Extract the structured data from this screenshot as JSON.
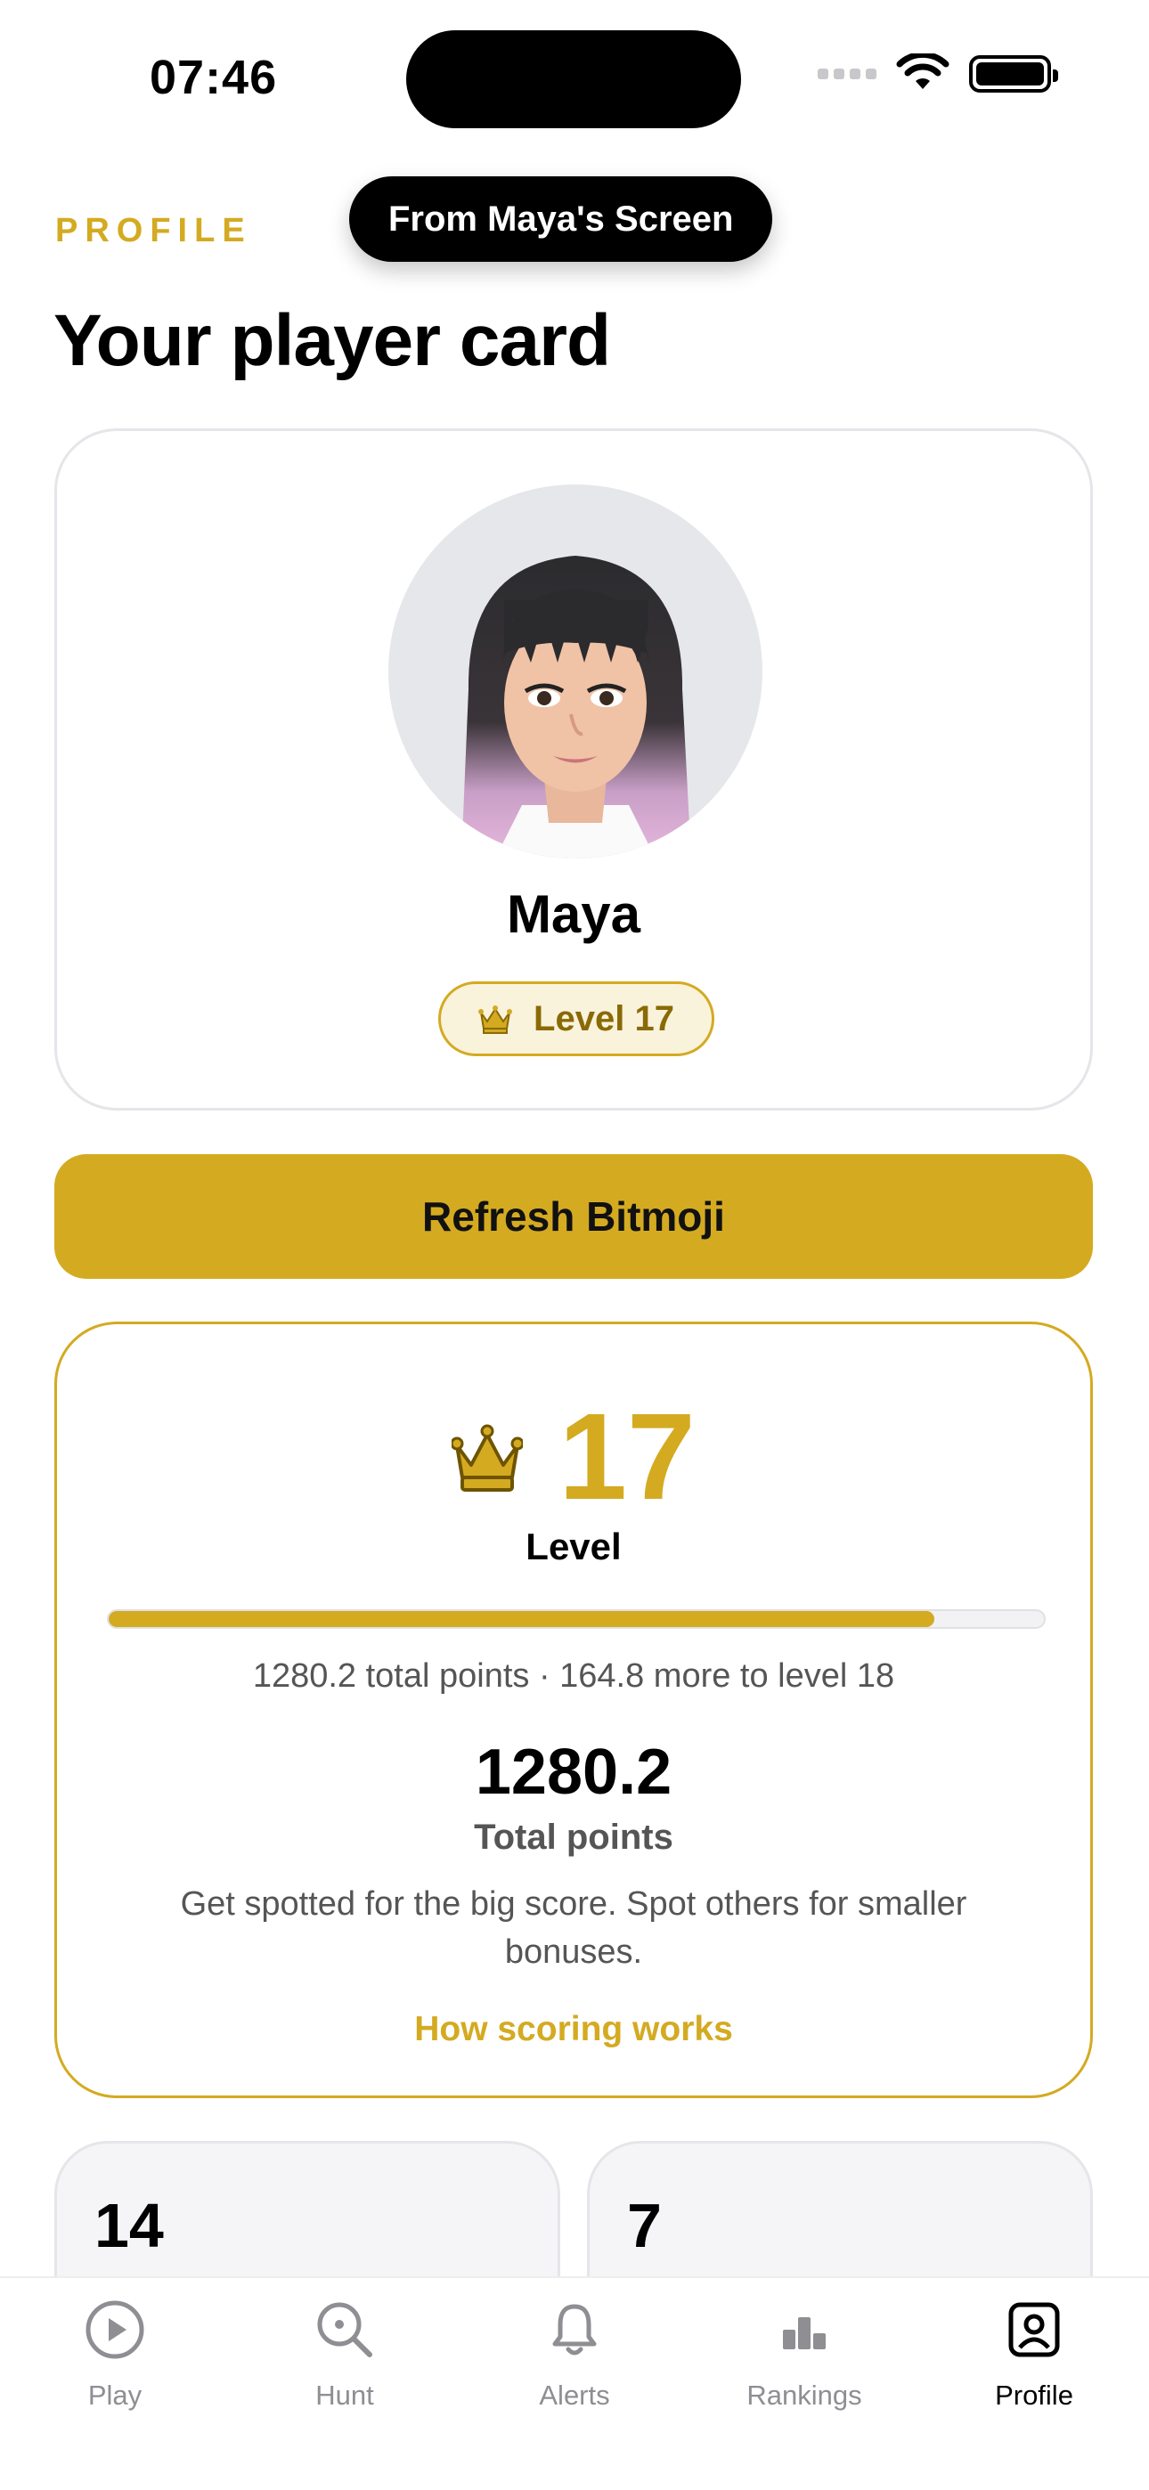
{
  "status_bar": {
    "time": "07:46"
  },
  "banner": {
    "text": "From Maya's Screen"
  },
  "header": {
    "section_label": "PROFILE",
    "title": "Your player card"
  },
  "profile": {
    "name": "Maya",
    "level_badge": "Level 17"
  },
  "actions": {
    "refresh_label": "Refresh Bitmoji"
  },
  "level_card": {
    "level": "17",
    "level_caption": "Level",
    "progress_fraction": 0.883,
    "progress_text": "1280.2 total points · 164.8 more to level 18",
    "total_points": "1280.2",
    "total_points_label": "Total points",
    "description": "Get spotted for the big score. Spot others for smaller bonuses.",
    "link_label": "How scoring works"
  },
  "stats": [
    {
      "value": "14"
    },
    {
      "value": "7"
    }
  ],
  "tab_bar": {
    "items": [
      {
        "label": "Play",
        "icon": "play-circle-icon"
      },
      {
        "label": "Hunt",
        "icon": "search-icon"
      },
      {
        "label": "Alerts",
        "icon": "bell-icon"
      },
      {
        "label": "Rankings",
        "icon": "bar-chart-icon"
      },
      {
        "label": "Profile",
        "icon": "profile-icon"
      }
    ],
    "active": "Profile"
  },
  "colors": {
    "accent": "#d4aa21",
    "accent_dark": "#8a6a05",
    "muted_text": "#555555"
  }
}
